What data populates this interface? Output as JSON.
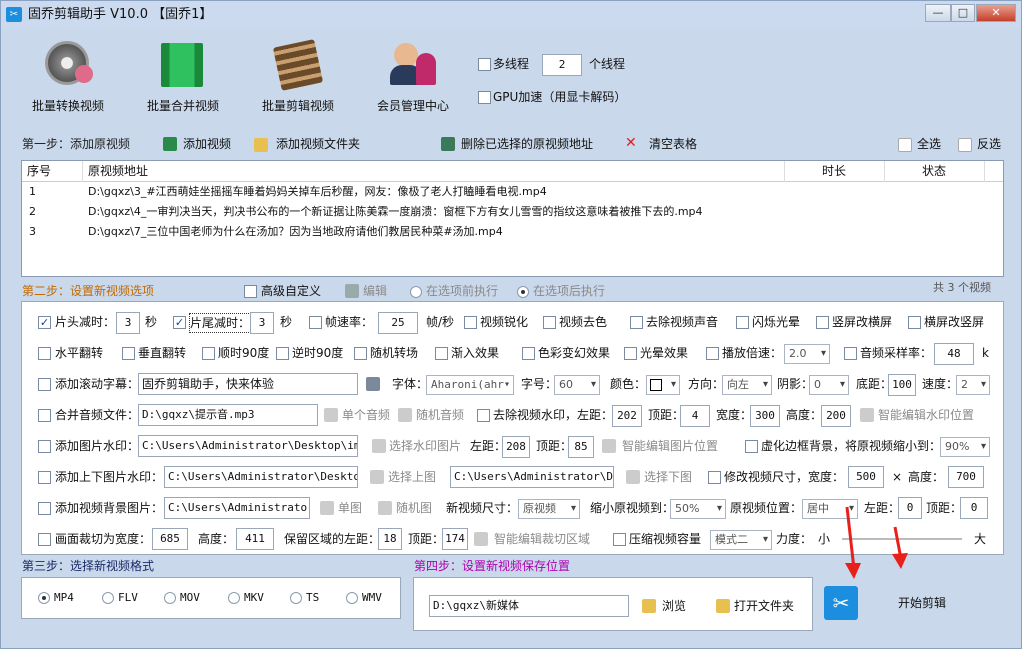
{
  "window": {
    "title": "固乔剪辑助手 V10.0 【固乔1】",
    "min": "—",
    "max": "□",
    "close": "✕"
  },
  "top": {
    "btn1": "批量转换视频",
    "btn2": "批量合并视频",
    "btn3": "批量剪辑视频",
    "btn4": "会员管理中心",
    "multi": "多线程",
    "threads": "2",
    "thread_unit": "个线程",
    "gpu": "GPU加速（用显卡解码）"
  },
  "step1": {
    "label": "第一步：添加原视频",
    "add_video": "添加视频",
    "add_folder": "添加视频文件夹",
    "delete_sel": "删除已选择的原视频地址",
    "clear": "清空表格",
    "select_all": "全选",
    "invert": "反选"
  },
  "table": {
    "headers": [
      "序号",
      "原视频地址",
      "时长",
      "状态"
    ],
    "rows": [
      {
        "n": "1",
        "path": "D:\\gqxz\\3_#江西萌娃坐摇摇车睡着妈妈关掉车后秒醒，网友：像极了老人打瞌睡看电视.mp4"
      },
      {
        "n": "2",
        "path": "D:\\gqxz\\4_一审判决当天，判决书公布的一个新证据让陈美霖一度崩溃：窗框下方有女儿雪雪的指纹这意味着被推下去的.mp4"
      },
      {
        "n": "3",
        "path": "D:\\gqxz\\7_三位中国老师为什么在汤加？因为当地政府请他们教居民种菜#汤加.mp4"
      }
    ],
    "count": "共 3 个视频"
  },
  "step2": {
    "label": "第二步：设置新视频选项",
    "advanced": "高级自定义",
    "edit": "编辑",
    "before": "在选项前执行",
    "after": "在选项后执行"
  },
  "r1": {
    "head_cut": "片头减时：",
    "head_val": "3",
    "sec": "秒",
    "tail_cut": "片尾减时：",
    "tail_val": "3",
    "sec2": "秒",
    "fps": "帧速率：",
    "fps_val": "25",
    "fps_unit": "帧/秒",
    "sharpen": "视频锐化",
    "decolor": "视频去色",
    "mute": "去除视频声音",
    "flash": "闪烁光晕",
    "v2h": "竖屏改横屏",
    "h2v": "横屏改竖屏"
  },
  "r2": {
    "hflip": "水平翻转",
    "vflip": "垂直翻转",
    "cw90": "顺时90度",
    "ccw90": "逆时90度",
    "trans": "随机转场",
    "fadein": "渐入效果",
    "color": "色彩变幻效果",
    "glow": "光晕效果",
    "speed": "播放倍速：",
    "speed_val": "2.0",
    "rate": "音频采样率：",
    "rate_val": "48",
    "k": "k"
  },
  "r3": {
    "scroll": "添加滚动字幕：",
    "scroll_text": "固乔剪辑助手，快来体验",
    "font": "字体：",
    "font_val": "Aharoni(ahr",
    "size": "字号：",
    "size_val": "60",
    "color": "颜色：",
    "dir": "方向：",
    "dir_val": "向左",
    "shadow": "阴影：",
    "shadow_val": "0",
    "bottom": "底距：",
    "bottom_val": "100",
    "spd": "速度：",
    "spd_val": "2"
  },
  "r4": {
    "merge": "合并音频文件：",
    "audio": "D:\\gqxz\\提示音.mp3",
    "single": "单个音频",
    "random": "随机音频",
    "rmwm": "去除视频水印，左距：",
    "left": "202",
    "top": "顶距：",
    "top_val": "4",
    "w": "宽度：",
    "w_val": "300",
    "h": "高度：",
    "h_val": "200",
    "smart": "智能编辑水印位置"
  },
  "r5": {
    "imgwm": "添加图片水印：",
    "path": "C:\\Users\\Administrator\\Desktop\\img-q",
    "choose": "选择水印图片",
    "left": "左距：",
    "left_val": "208",
    "top": "顶距：",
    "top_val": "85",
    "smart": "智能编辑图片位置",
    "blur": "虚化边框背景，将原视频缩小到：",
    "blur_val": "90%"
  },
  "r6": {
    "tb": "添加上下图片水印：",
    "top_path": "C:\\Users\\Administrator\\Desktop\\i",
    "choose_top": "选择上图",
    "bot_path": "C:\\Users\\Administrator\\Desk",
    "choose_bot": "选择下图",
    "resize": "修改视频尺寸，宽度：",
    "w": "500",
    "x": "×",
    "h": "高度：",
    "h_val": "700"
  },
  "r7": {
    "bg": "添加视频背景图片：",
    "path": "C:\\Users\\Administrator\\D",
    "single": "单图",
    "random": "随机图",
    "size": "新视频尺寸：",
    "size_val": "原视频",
    "shrink": "缩小原视频到：",
    "shrink_val": "50%",
    "pos": "原视频位置：",
    "pos_val": "居中",
    "left": "左距：",
    "left_val": "0",
    "top": "顶距：",
    "top_val": "0"
  },
  "r8": {
    "crop": "画面裁切为宽度：",
    "w": "685",
    "h": "高度：",
    "h_val": "411",
    "keep": "保留区域的左距：",
    "left": "18",
    "top": "顶距：",
    "top_val": "174",
    "smart": "智能编辑裁切区域",
    "compress": "压缩视频容量",
    "mode": "模式二",
    "force": "力度：",
    "small": "小",
    "big": "大"
  },
  "step3": {
    "label": "第三步：选择新视频格式",
    "formats": [
      "MP4",
      "FLV",
      "MOV",
      "MKV",
      "TS",
      "WMV"
    ]
  },
  "step4": {
    "label": "第四步：设置新视频保存位置",
    "path": "D:\\gqxz\\新媒体",
    "browse": "浏览",
    "open": "打开文件夹",
    "start": "开始剪辑"
  },
  "colors": {
    "step_label": "#c46a00",
    "step4_label": "#b000b0",
    "arrow": "#e8201c",
    "start_btn": "#1b8ee0"
  }
}
